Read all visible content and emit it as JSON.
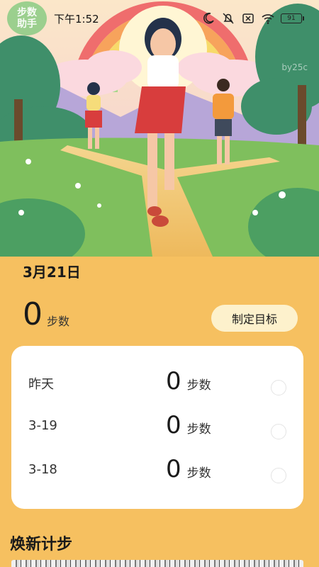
{
  "status_bar": {
    "app_badge": [
      "步数",
      "助手"
    ],
    "time": "下午1:52",
    "battery": "91",
    "icons": [
      "moon-icon",
      "bell-muted-icon",
      "sim-off-icon",
      "wifi-icon",
      "battery-icon"
    ]
  },
  "hero": {
    "watermark": "by25c",
    "illustration": "walking-path-illustration"
  },
  "today": {
    "date": "3月21日",
    "steps": "0",
    "unit": "步数",
    "goal_button": "制定目标"
  },
  "history": [
    {
      "label": "昨天",
      "steps": "0",
      "unit": "步数"
    },
    {
      "label": "3-19",
      "steps": "0",
      "unit": "步数"
    },
    {
      "label": "3-18",
      "steps": "0",
      "unit": "步数"
    }
  ],
  "section": {
    "title": "焕新计步"
  },
  "colors": {
    "background": "#f6c060",
    "card": "#ffffff",
    "goal_button": "#fdf1cc"
  }
}
